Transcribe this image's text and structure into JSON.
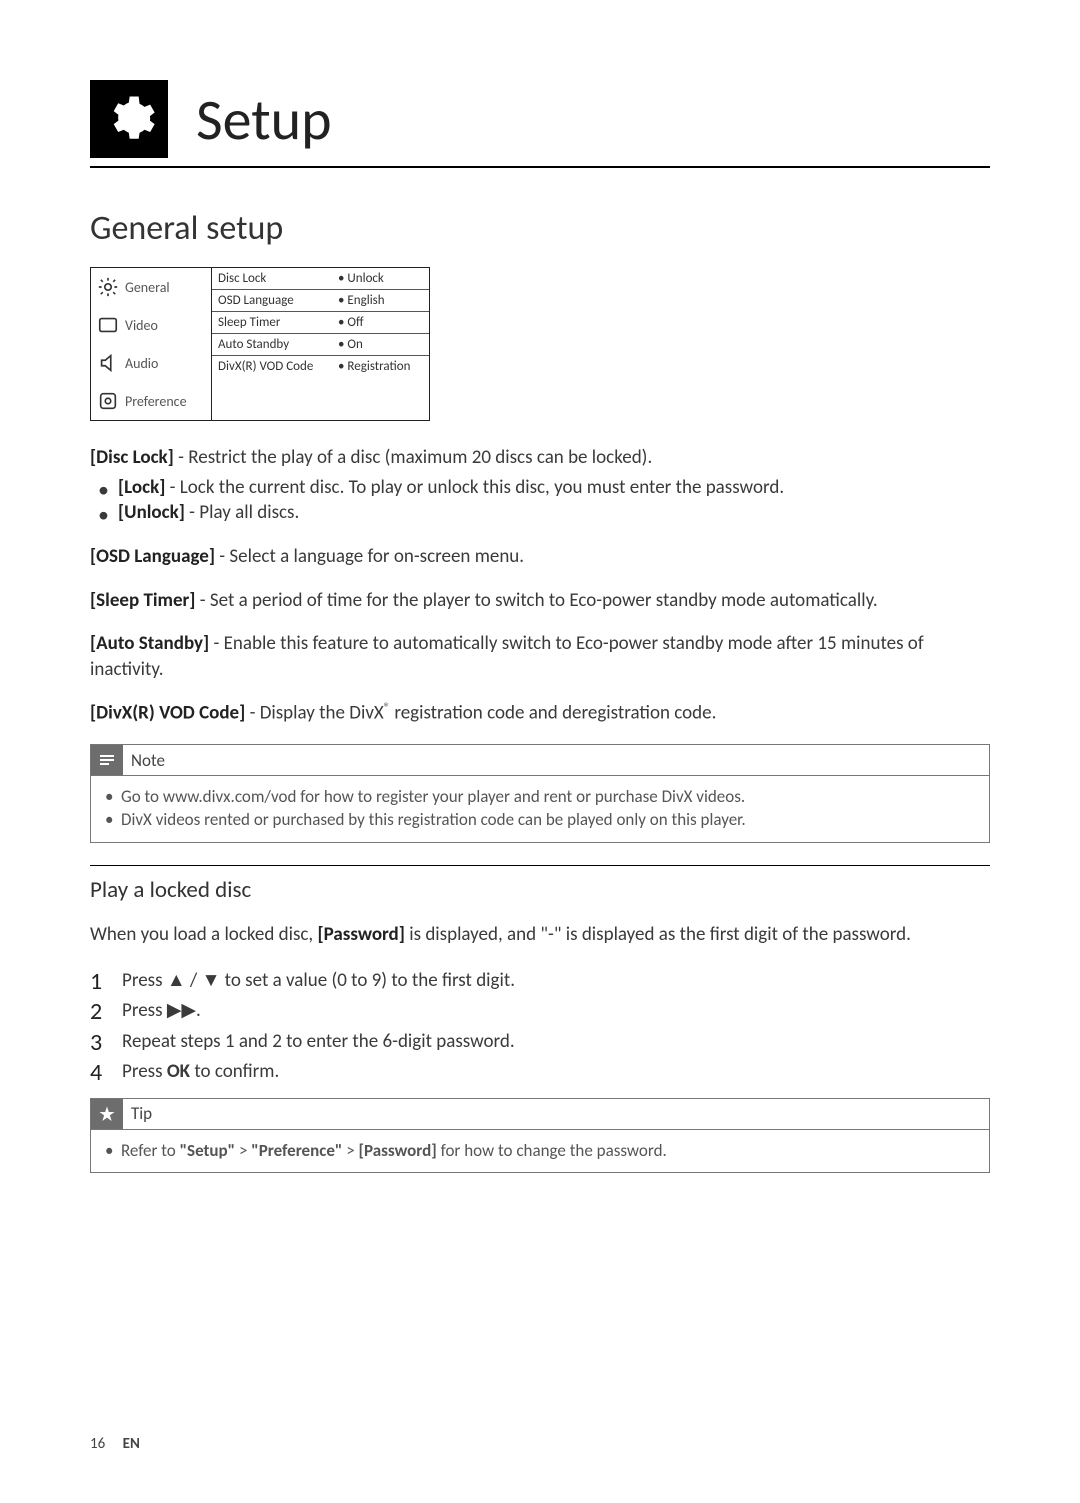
{
  "header": {
    "title": "Setup"
  },
  "section": {
    "title": "General setup"
  },
  "menu": {
    "tabs": [
      {
        "label": "General"
      },
      {
        "label": "Video"
      },
      {
        "label": "Audio"
      },
      {
        "label": "Preference"
      }
    ],
    "rows": [
      {
        "label": "Disc Lock",
        "value": "Unlock"
      },
      {
        "label": "OSD Language",
        "value": "English"
      },
      {
        "label": "Sleep Timer",
        "value": "Off"
      },
      {
        "label": "Auto Standby",
        "value": "On"
      },
      {
        "label": "DivX(R) VOD Code",
        "value": "Registration"
      }
    ]
  },
  "desc": {
    "discLock": {
      "term": "[Disc Lock]",
      "text": " - Restrict the play of a disc (maximum 20 discs can be locked)."
    },
    "discLockOpts": [
      {
        "term": "[Lock]",
        "text": " - Lock the current disc. To play or unlock this disc, you must enter the password."
      },
      {
        "term": "[Unlock]",
        "text": " - Play all discs."
      }
    ],
    "osd": {
      "term": "[OSD Language]",
      "text": " - Select a language for on-screen menu."
    },
    "sleep": {
      "term": "[Sleep Timer]",
      "text": " - Set a period of time for the player to switch to Eco-power standby mode automatically."
    },
    "auto": {
      "term": "[Auto Standby]",
      "text": " - Enable this feature to automatically switch to Eco-power standby mode after 15 minutes of inactivity."
    },
    "divx": {
      "term": "[DivX(R) VOD Code]",
      "text1": " - Display the DivX",
      "reg": "®",
      "text2": " registration code and deregistration code."
    }
  },
  "note": {
    "title": "Note",
    "items": [
      "Go to www.divx.com/vod for how to register your player and rent or purchase DivX videos.",
      "DivX videos rented or purchased by this registration code can be played only on this player."
    ]
  },
  "play": {
    "title": "Play a locked disc",
    "intro1": "When you load a locked disc, ",
    "introTerm": "[Password]",
    "intro2": " is displayed, and \"-\" is displayed as the first digit of the password.",
    "steps": {
      "s1a": "Press ",
      "s1b": " / ",
      "s1c": " to set a value (0 to 9) to the first digit.",
      "s2a": "Press ",
      "s2b": ".",
      "s3": "Repeat steps 1 and 2 to enter the 6-digit password.",
      "s4a": "Press ",
      "s4b": "OK",
      "s4c": " to confirm."
    }
  },
  "tip": {
    "title": "Tip",
    "item1a": "Refer to ",
    "item1b": "\"Setup\"",
    "item1c": " > ",
    "item1d": "\"Preference\"",
    "item1e": " > ",
    "item1f": "[Password]",
    "item1g": " for how to change the password."
  },
  "footer": {
    "page": "16",
    "lang": "EN"
  },
  "glyphs": {
    "up": "▲",
    "down": "▼",
    "ff": "▶▶"
  }
}
